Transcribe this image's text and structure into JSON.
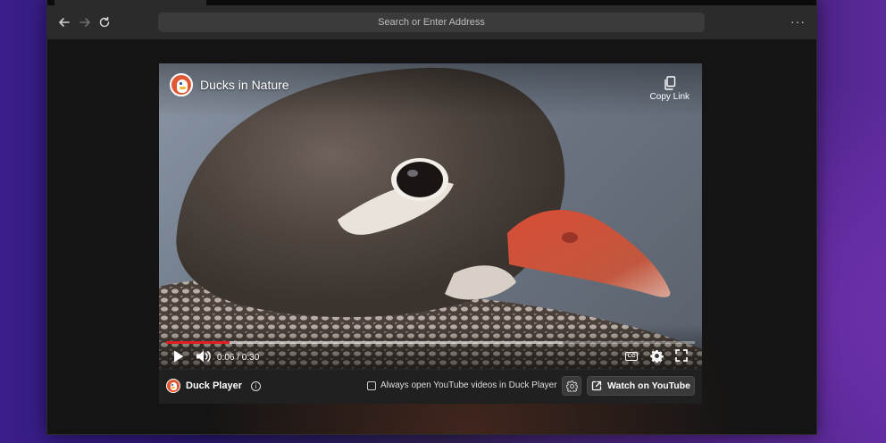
{
  "address_bar": {
    "placeholder": "Search or Enter Address"
  },
  "video": {
    "title": "Ducks in Nature",
    "copy_link_label": "Copy Link",
    "current_time": "0:06",
    "duration": "0:30",
    "time_display": "0:06 / 0:30",
    "progress_fraction": 0.12,
    "buffered_fraction": 0.75,
    "cc_label": "CC"
  },
  "duck_player_bar": {
    "brand_name": "Duck Player",
    "always_open_label": "Always open YouTube videos in Duck Player",
    "always_open_checked": false,
    "watch_on_youtube_label": "Watch on YouTube"
  },
  "colors": {
    "brand_orange": "#de5833",
    "progress_red": "#e02020",
    "window_bg": "#131313",
    "toolbar_bg": "#2b2b2b"
  },
  "icons": [
    "back-icon",
    "forward-icon",
    "reload-icon",
    "more-menu-icon",
    "duckduckgo-logo-icon",
    "copy-icon",
    "play-icon",
    "volume-icon",
    "cc-icon",
    "settings-gear-icon",
    "fullscreen-icon",
    "info-icon",
    "external-link-icon"
  ]
}
